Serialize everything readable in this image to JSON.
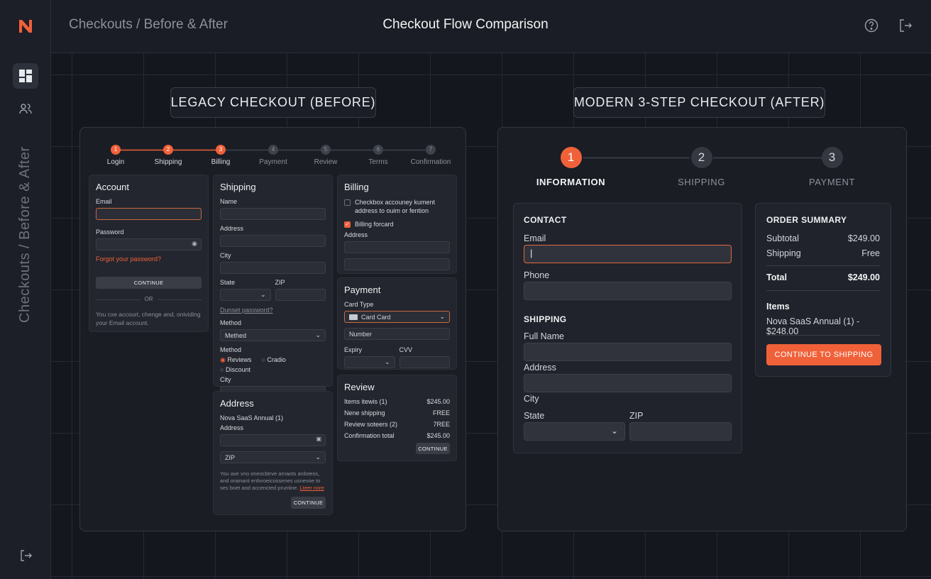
{
  "app": {
    "brand": "N"
  },
  "header": {
    "breadcrumb": "Checkouts / Before & After",
    "title": "Checkout Flow Comparison"
  },
  "sidebar": {
    "vertical_label": "Checkouts / Before & After"
  },
  "colors": {
    "accent": "#f0613a",
    "bg": "#161921",
    "panel": "#1a1d24"
  },
  "legacy": {
    "label": "LEGACY CHECKOUT (BEFORE)",
    "steps": [
      {
        "n": "1",
        "label": "Login"
      },
      {
        "n": "2",
        "label": "Shipping"
      },
      {
        "n": "3",
        "label": "Billing"
      },
      {
        "n": "4",
        "label": "Payment"
      },
      {
        "n": "5",
        "label": "Review"
      },
      {
        "n": "6",
        "label": "Terms"
      },
      {
        "n": "7",
        "label": "Confirmation"
      }
    ],
    "account": {
      "title": "Account",
      "email": "Email",
      "password": "Password",
      "forgot": "Forgot your password?",
      "continue": "CONTINUE",
      "or": "OR",
      "note": "You cxe accourt, chenge and, onividing your Email account."
    },
    "shipping": {
      "title": "Shipping",
      "name": "Name",
      "address": "Address",
      "city": "City",
      "state": "State",
      "zip": "ZIP",
      "dunset": "Dunset password?",
      "method": "Method",
      "method_value": "Methed",
      "method2": "Method",
      "radio1": "Reviews",
      "radio2": "Cradio",
      "radio3": "Discount",
      "city2": "City"
    },
    "address": {
      "title": "Address",
      "product": "Nova SaaS Annual (1)",
      "address": "Address",
      "zip": "ZIP",
      "note": "You axe vno oneocbtrve arnaots ardotess, and orainant enforoeicossenes usnevoe to ses boet aod accencted pruntine.",
      "link": "Lteer nore",
      "continue": "CONTINUE"
    },
    "billing": {
      "title": "Billing",
      "check1": "Checkbox accouney kument address to ouim or fention",
      "check2": "Billing forcard",
      "address": "Address"
    },
    "payment": {
      "title": "Payment",
      "card_type": "Card Type",
      "card_value": "Card Card",
      "number": "Number",
      "expiry": "Expiry",
      "cvv": "CVV"
    },
    "review": {
      "title": "Review",
      "rows": [
        {
          "label": "Items itewis (1)",
          "value": "$245.00"
        },
        {
          "label": "Nene shipping",
          "value": "FREE"
        },
        {
          "label": "Review soteers (2)",
          "value": "7REE"
        },
        {
          "label": "Confirmation total",
          "value": "$245.00"
        }
      ],
      "continue": "CONTINUE"
    }
  },
  "modern": {
    "label": "MODERN 3-STEP CHECKOUT (AFTER)",
    "steps": [
      {
        "n": "1",
        "label": "INFORMATION"
      },
      {
        "n": "2",
        "label": "SHIPPING"
      },
      {
        "n": "3",
        "label": "PAYMENT"
      }
    ],
    "contact": {
      "title": "CONTACT",
      "email": "Email",
      "email_value": "|",
      "phone": "Phone"
    },
    "shipping": {
      "title": "SHIPPING",
      "full_name": "Full Name",
      "address": "Address",
      "city": "City",
      "state": "State",
      "zip": "ZIP"
    },
    "summary": {
      "title": "ORDER SUMMARY",
      "subtotal_label": "Subtotal",
      "subtotal": "$249.00",
      "shipping_label": "Shipping",
      "shipping": "Free",
      "total_label": "Total",
      "total": "$249.00",
      "items_label": "Items",
      "item": "Nova SaaS Annual (1) - $248.00",
      "cta": "CONTINUE TO SHIPPING"
    }
  }
}
